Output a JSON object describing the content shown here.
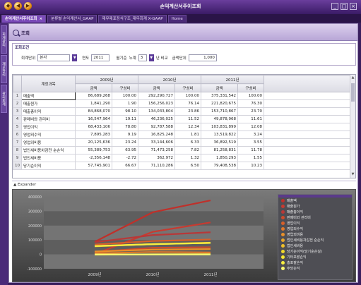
{
  "window": {
    "title": "손익계산서주이조회",
    "controls": [
      "_",
      "□",
      "×"
    ]
  },
  "tabs": [
    {
      "label": "손익계산서주이조회",
      "active": true
    },
    {
      "label": "분류별 손익계산서_GAAP",
      "active": false
    },
    {
      "label": "재무제표정식구조_재무회계 X-GAAP",
      "active": false
    },
    {
      "label": "Home",
      "active": false
    }
  ],
  "rail": [
    "회계관리",
    "재무관리",
    "관리회계"
  ],
  "toolbar": {
    "search_label": "조회"
  },
  "filter": {
    "title": "조회조건",
    "unit_label": "회계단위",
    "unit_value": "본사",
    "year_label": "연도",
    "year_value": "2011",
    "period_label": "월기준",
    "period_type": "누계",
    "period_value": "3",
    "compare_label": "년 비교",
    "amount_label": "금액단위",
    "amount_value": "1,000"
  },
  "grid": {
    "account_header": "계정과목",
    "years": [
      "2009년",
      "2010년",
      "2011년"
    ],
    "sub_headers": [
      "금액",
      "구성비"
    ],
    "rows": [
      {
        "no": "1",
        "account": "매출액",
        "v": [
          "86,689,268",
          "100.00",
          "292,290,727",
          "100.00",
          "375,331,542",
          "100.00"
        ]
      },
      {
        "no": "2",
        "account": "매출원가",
        "v": [
          "1,841,290",
          "1.90",
          "156,256,023",
          "76.14",
          "221,820,675",
          "76.30"
        ]
      },
      {
        "no": "3",
        "account": "매출총이익",
        "v": [
          "84,868,070",
          "98.10",
          "134,033,804",
          "23.86",
          "153,710,867",
          "23.70"
        ]
      },
      {
        "no": "4",
        "account": "판매비와 관리비",
        "v": [
          "16,547,964",
          "19.11",
          "46,236,025",
          "11.52",
          "49,878,968",
          "11.61"
        ]
      },
      {
        "no": "5",
        "account": "영업이익",
        "v": [
          "68,433,106",
          "78.80",
          "92,787,588",
          "12.34",
          "103,831,899",
          "12.08"
        ]
      },
      {
        "no": "6",
        "account": "영업외수익",
        "v": [
          "7,895,283",
          "9.19",
          "16,825,248",
          "1.81",
          "13,519,822",
          "3.24"
        ]
      },
      {
        "no": "7",
        "account": "영업외비용",
        "v": [
          "20,125,636",
          "23.24",
          "33,144,606",
          "6.33",
          "36,892,519",
          "3.55"
        ]
      },
      {
        "no": "8",
        "account": "법인세비용차감전 순손익",
        "v": [
          "55,389,753",
          "63.95",
          "71,473,258",
          "7.82",
          "81,258,831",
          "11.78"
        ]
      },
      {
        "no": "9",
        "account": "법인세비용",
        "v": [
          "-2,356,148",
          "-2.72",
          "362,972",
          "1.32",
          "1,850,293",
          "1.55"
        ]
      },
      {
        "no": "10",
        "account": "당기순이익",
        "v": [
          "57,745,901",
          "66.67",
          "71,110,286",
          "6.50",
          "79,408,538",
          "10.23"
        ]
      }
    ]
  },
  "expander": {
    "label": "Expander"
  },
  "chart_data": {
    "type": "line",
    "x": [
      "2009년",
      "2010년",
      "2011년"
    ],
    "y_ticks": [
      "400000",
      "300000",
      "200000",
      "100000",
      "0",
      "-100000"
    ],
    "ylim": [
      -100000,
      400000
    ],
    "series": [
      {
        "name": "매출액",
        "color": "#c0302a",
        "values": [
          86689,
          292291,
          375332
        ]
      },
      {
        "name": "매출원가",
        "color": "#c83a30",
        "values": [
          1841,
          156256,
          221821
        ]
      },
      {
        "name": "매출총이익",
        "color": "#b83838",
        "values": [
          84868,
          134034,
          153711
        ]
      },
      {
        "name": "판매비와 관리비",
        "color": "#d04a2a",
        "values": [
          16548,
          46236,
          49879
        ]
      },
      {
        "name": "영업이익",
        "color": "#d8602a",
        "values": [
          68433,
          92788,
          103832
        ]
      },
      {
        "name": "영업외수익",
        "color": "#e0782a",
        "values": [
          7895,
          16825,
          13520
        ]
      },
      {
        "name": "영업외비용",
        "color": "#e8902a",
        "values": [
          20126,
          33145,
          36893
        ]
      },
      {
        "name": "법인세비용차감전 순손익",
        "color": "#e8a82a",
        "values": [
          55390,
          71473,
          81259
        ]
      },
      {
        "name": "법인세비용",
        "color": "#f0c02a",
        "values": [
          -2356,
          363,
          1850
        ]
      },
      {
        "name": "당기순이익(당기순손실)",
        "color": "#f0d82a",
        "values": [
          57746,
          71110,
          79409
        ]
      },
      {
        "name": "기타포괄손익",
        "color": "#f8e830",
        "values": [
          0,
          0,
          0
        ]
      },
      {
        "name": "총포괄손익",
        "color": "#f8f040",
        "values": [
          57746,
          71110,
          79409
        ]
      },
      {
        "name": "주당손익",
        "color": "#f8f870",
        "values": [
          0,
          0,
          0
        ]
      }
    ]
  }
}
